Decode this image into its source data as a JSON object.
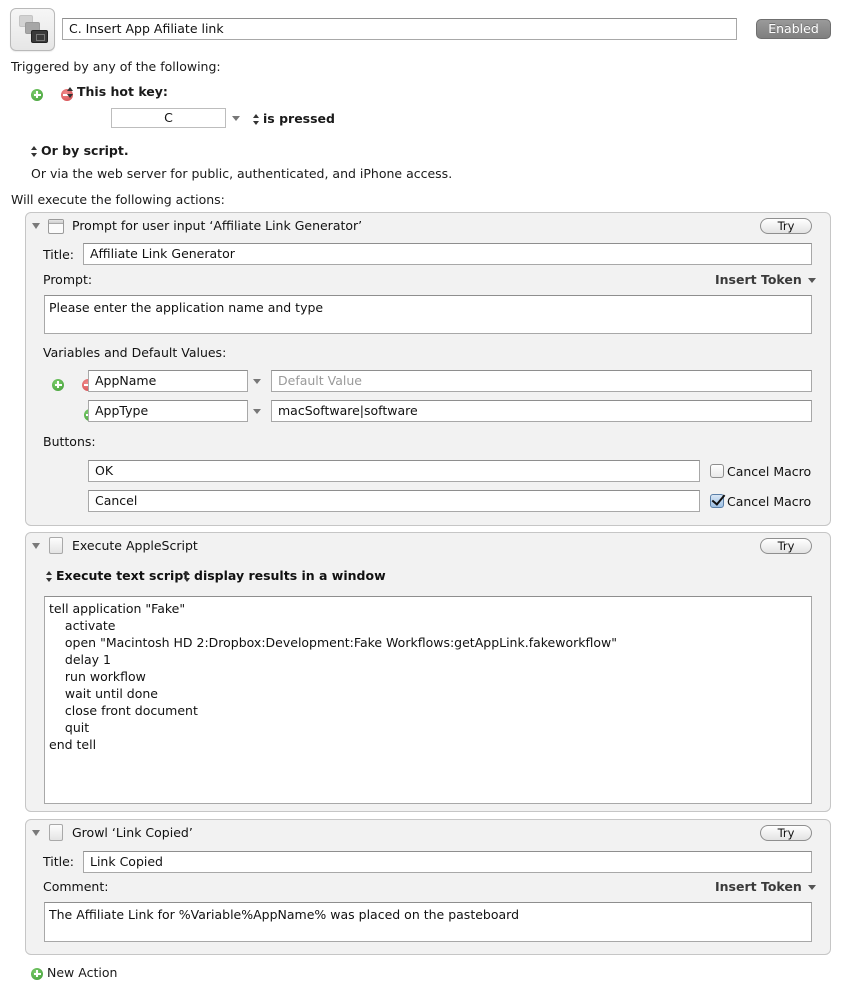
{
  "macro": {
    "icon": "macro-group-icon",
    "name": "C. Insert App Afiliate link",
    "enabled_label": "Enabled"
  },
  "triggers": {
    "heading": "Triggered by any of the following:",
    "hotkey_trigger_label": "This hot key:",
    "hotkey_value": "C",
    "hotkey_condition": "is pressed",
    "script_trigger_label": "Or by script.",
    "web_server_text": "Or via the web server for public, authenticated, and iPhone access."
  },
  "actions_heading": "Will execute the following actions:",
  "actions": [
    {
      "type": "prompt",
      "icon": "window-icon",
      "title": "Prompt for user input ‘Affiliate Link Generator’",
      "try_label": "Try",
      "title_label": "Title:",
      "title_value": "Affiliate Link Generator",
      "prompt_label": "Prompt:",
      "insert_token_label": "Insert Token",
      "prompt_value": "Please enter the application name and type",
      "variables_label": "Variables and Default Values:",
      "variables": [
        {
          "name": "AppName",
          "default_value": "",
          "default_placeholder": "Default Value"
        },
        {
          "name": "AppType",
          "default_value": "macSoftware|software",
          "default_placeholder": "Default Value"
        }
      ],
      "buttons_label": "Buttons:",
      "buttons": [
        {
          "name": "OK",
          "cancel_macro_label": "Cancel Macro",
          "cancel_macro": false
        },
        {
          "name": "Cancel",
          "cancel_macro_label": "Cancel Macro",
          "cancel_macro": true
        }
      ]
    },
    {
      "type": "applescript",
      "icon": "script-document-icon",
      "title": "Execute AppleScript",
      "try_label": "Try",
      "mode_label": "Execute text script",
      "results_label": "display results in a window",
      "script": "tell application \"Fake\"\n\tactivate\n\topen \"Macintosh HD 2:Dropbox:Development:Fake Workflows:getAppLink.fakeworkflow\"\n\tdelay 1\n\trun workflow\n\twait until done\n\tclose front document\n\tquit\nend tell"
    },
    {
      "type": "growl",
      "icon": "growl-document-icon",
      "title": "Growl ‘Link Copied’",
      "try_label": "Try",
      "title_label": "Title:",
      "title_value": "Link Copied",
      "comment_label": "Comment:",
      "insert_token_label": "Insert Token",
      "comment_value": "The Affiliate Link for %Variable%AppName% was placed on the pasteboard"
    }
  ],
  "new_action_label": "New Action"
}
